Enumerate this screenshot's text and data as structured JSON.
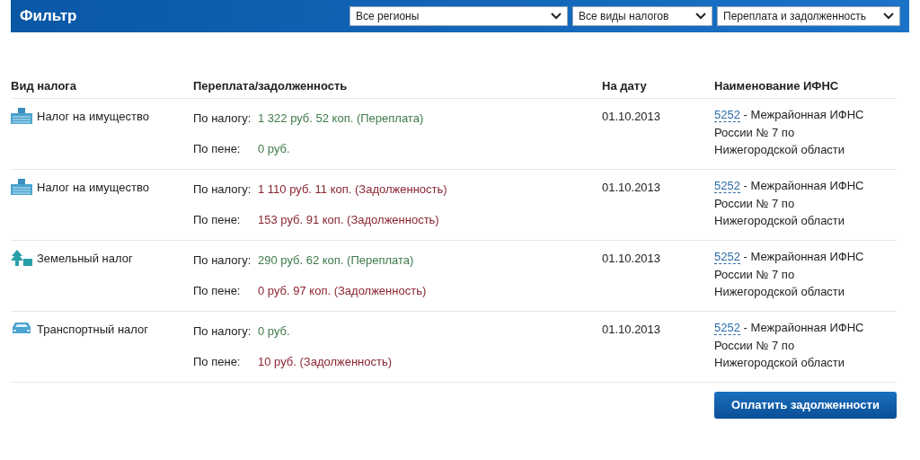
{
  "filter": {
    "title": "Фильтр",
    "selects": [
      {
        "value": "Все регионы"
      },
      {
        "value": "Все виды налогов"
      },
      {
        "value": "Переплата и задолженность"
      }
    ]
  },
  "table": {
    "columns": [
      "Вид налога",
      "Переплата/задолженность",
      "На дату",
      "Наименование ИФНС"
    ],
    "rows": [
      {
        "kind": "property",
        "tax": "Налог на имущество",
        "lines": [
          {
            "label": "По налогу:",
            "amount": "1 322 руб. 52 коп. (Переплата)",
            "color": "#3f7a4a"
          },
          {
            "label": "По пене:",
            "amount": "0 руб.",
            "color": "#3f7a4a"
          }
        ],
        "date": "01.10.2013",
        "ifns_code": "5252",
        "ifns_name": " - Межрайонная ИФНС России № 7 по Нижегородской области"
      },
      {
        "kind": "property",
        "tax": "Налог на имущество",
        "lines": [
          {
            "label": "По налогу:",
            "amount": "1 110 руб. 11 коп. (Задолженность)",
            "color": "#8a2530"
          },
          {
            "label": "По пене:",
            "amount": "153 руб. 91 коп. (Задолженность)",
            "color": "#8a2530"
          }
        ],
        "date": "01.10.2013",
        "ifns_code": "5252",
        "ifns_name": " - Межрайонная ИФНС России № 7 по Нижегородской области"
      },
      {
        "kind": "land",
        "tax": "Земельный налог",
        "lines": [
          {
            "label": "По налогу:",
            "amount": "290 руб. 62 коп. (Переплата)",
            "color": "#3f7a4a"
          },
          {
            "label": "По пене:",
            "amount": "0 руб. 97 коп. (Задолженность)",
            "color": "#8a2530"
          }
        ],
        "date": "01.10.2013",
        "ifns_code": "5252",
        "ifns_name": " - Межрайонная ИФНС России № 7 по Нижегородской области"
      },
      {
        "kind": "transport",
        "tax": "Транспортный налог",
        "lines": [
          {
            "label": "По налогу:",
            "amount": "0 руб.",
            "color": "#3f7a4a"
          },
          {
            "label": "По пене:",
            "amount": "10 руб. (Задолженность)",
            "color": "#8a2530"
          }
        ],
        "date": "01.10.2013",
        "ifns_code": "5252",
        "ifns_name": " - Межрайонная ИФНС России № 7 по Нижегородской области"
      }
    ]
  },
  "pay_button": "Оплатить задолженности"
}
